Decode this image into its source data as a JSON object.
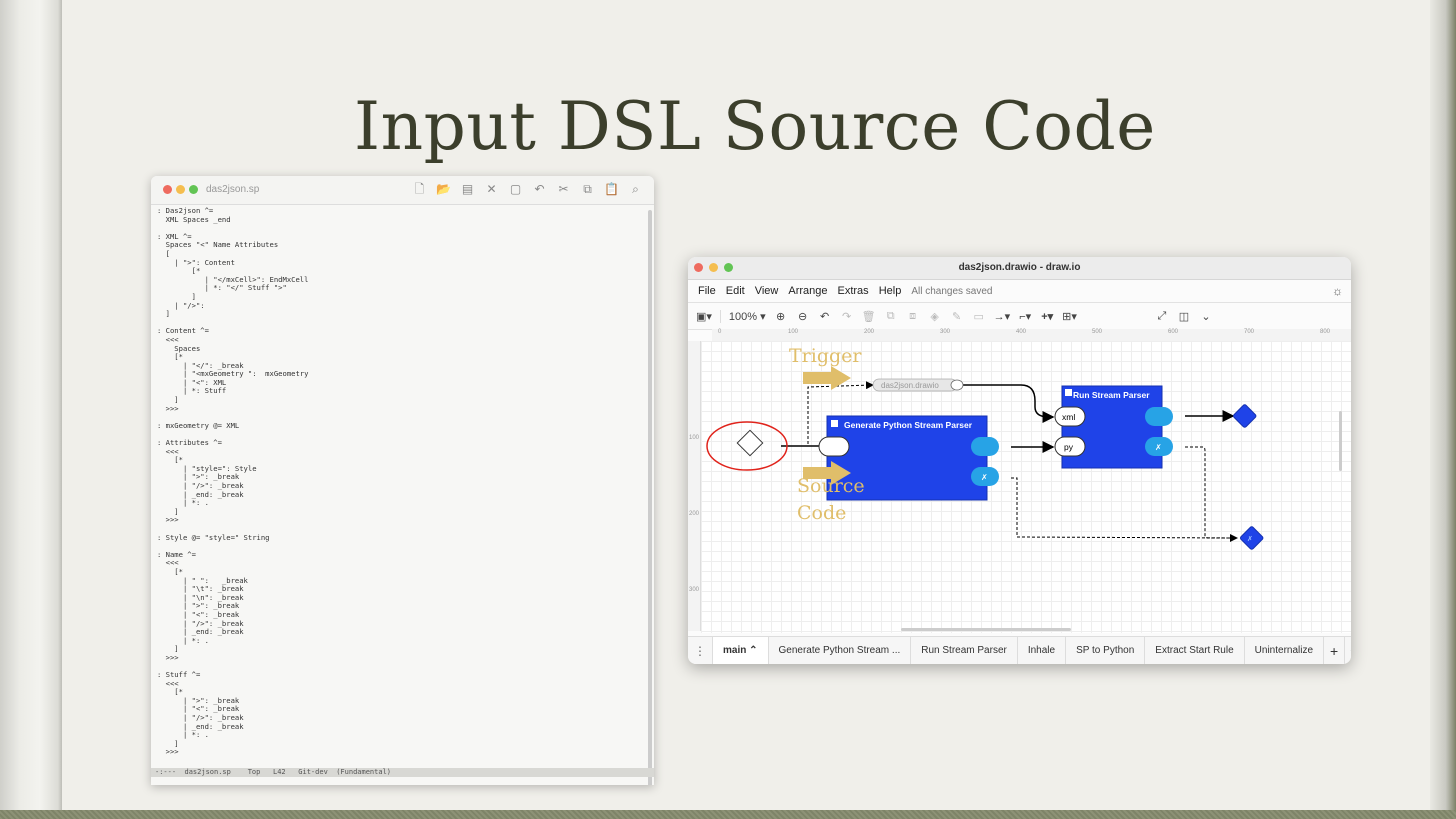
{
  "slide": {
    "title": "Input DSL Source Code"
  },
  "editor": {
    "window_title": "das2json.sp",
    "code": ": Das2json ^=\n  XML Spaces _end\n\n: XML ^=\n  Spaces \"<\" Name Attributes\n  [\n    | \">\": Content\n        [*\n           | \"</mxCell>\": EndMxCell\n           | *: \"</\" Stuff \">\"\n        ]\n    | \"/>\":\n  ]\n\n: Content ^=\n  <<<\n    Spaces\n    [*\n      | \"</\": _break\n      | \"<mxGeometry \":  mxGeometry\n      | \"<\": XML\n      | *: Stuff\n    ]\n  >>>\n\n: mxGeometry @= XML\n\n: Attributes ^=\n  <<<\n    [*\n      | \"style=\": Style\n      | \">\": _break\n      | \"/>\": _break\n      | _end: _break\n      | *: .\n    ]\n  >>>\n\n: Style @= \"style=\" String\n\n: Name ^=\n  <<<\n    [*\n      | \" \":   _break\n      | \"\\t\": _break\n      | \"\\n\": _break\n      | \">\": _break\n      | \"<\": _break\n      | \"/>\": _break\n      | _end: _break\n      | *: .\n    ]\n  >>>\n\n: Stuff ^=\n  <<<\n    [*\n      | \">\": _break\n      | \"<\": _break\n      | \"/>\": _break\n      | _end: _break\n      | *: .\n    ]\n  >>>",
    "status": "-:---  das2json.sp    Top   L42   Git-dev  (Fundamental)"
  },
  "drawio": {
    "window_title": "das2json.drawio - draw.io",
    "menu": [
      "File",
      "Edit",
      "View",
      "Arrange",
      "Extras",
      "Help"
    ],
    "saved_status": "All changes saved",
    "zoom": "100%",
    "ruler_top": [
      "0",
      "100",
      "200",
      "300",
      "400",
      "500",
      "600",
      "700",
      "800"
    ],
    "ruler_left": [
      "100",
      "200",
      "300"
    ],
    "diagram": {
      "annotation_trigger": "Trigger",
      "annotation_source_1": "Source",
      "annotation_source_2": "Code",
      "node_das2json": "das2json.drawio",
      "node_generate": "Generate Python Stream Parser",
      "node_run": "Run Stream Parser",
      "port_xml": "xml",
      "port_py": "py",
      "port_x": "✗"
    },
    "tabs": [
      "main",
      "Generate Python Stream ...",
      "Run Stream Parser",
      "Inhale",
      "SP to Python",
      "Extract Start Rule",
      "Uninternalize"
    ]
  },
  "colors": {
    "accent_blue": "#1f43e8",
    "port_blue": "#27a3e6",
    "annotation_gold": "#e0be6a",
    "circle_red": "#e0231b"
  }
}
